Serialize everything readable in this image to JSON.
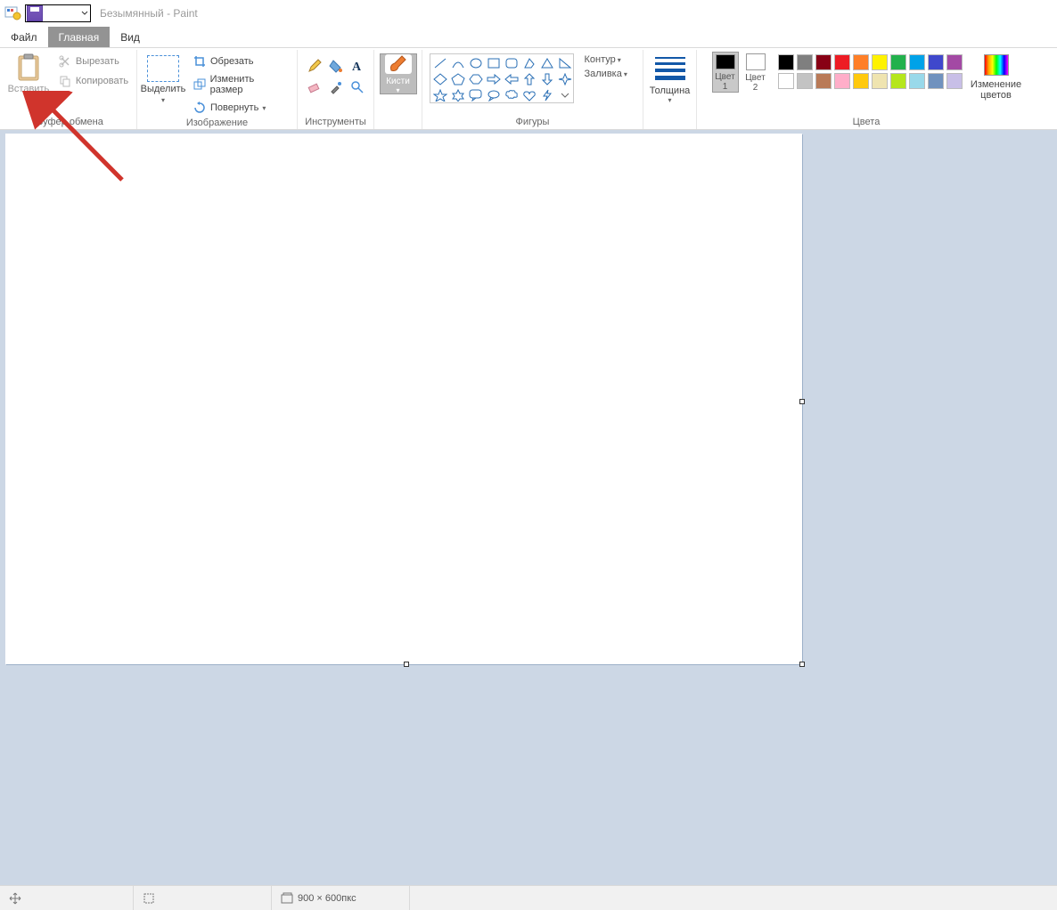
{
  "title": "Безымянный - Paint",
  "tabs": {
    "file": "Файл",
    "home": "Главная",
    "view": "Вид"
  },
  "groups": {
    "clipboard": {
      "label": "Буфер обмена",
      "paste": "Вставить",
      "cut": "Вырезать",
      "copy": "Копировать"
    },
    "image": {
      "label": "Изображение",
      "select": "Выделить",
      "crop": "Обрезать",
      "resize": "Изменить размер",
      "rotate": "Повернуть"
    },
    "tools": {
      "label": "Инструменты"
    },
    "brushes": {
      "label": "Кисти"
    },
    "shapes": {
      "label": "Фигуры",
      "outline": "Контур",
      "fill": "Заливка"
    },
    "thickness": {
      "label": "Толщина"
    },
    "colors": {
      "label": "Цвета",
      "color1": "Цвет 1",
      "color2": "Цвет 2",
      "editColors": "Изменение цветов"
    }
  },
  "colorSlots": {
    "color1": "#000000",
    "color2": "#ffffff"
  },
  "palette": [
    "#000000",
    "#7f7f7f",
    "#880015",
    "#ed1c24",
    "#ff7f27",
    "#fff200",
    "#22b14c",
    "#00a2e8",
    "#3f48cc",
    "#a349a4",
    "#ffffff",
    "#c3c3c3",
    "#b97a57",
    "#ffaec9",
    "#ffc90e",
    "#efe4b0",
    "#b5e61d",
    "#99d9ea",
    "#7092be",
    "#c8bfe7"
  ],
  "status": {
    "dimensions": "900 × 600пкс"
  }
}
